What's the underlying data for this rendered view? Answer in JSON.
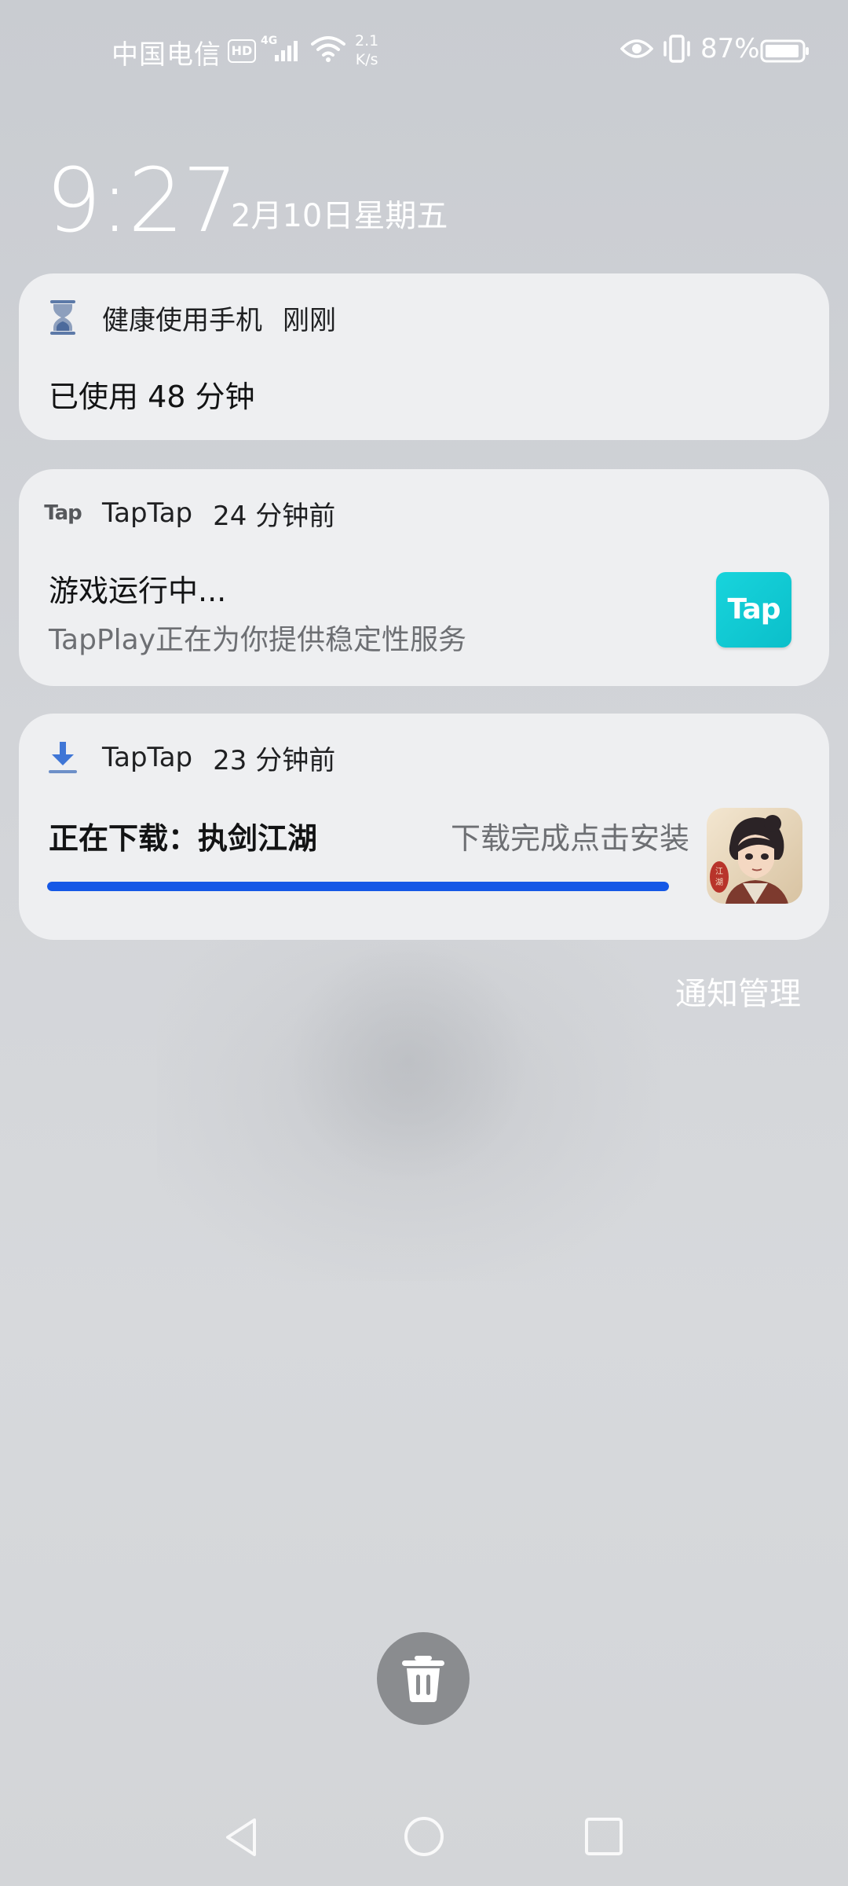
{
  "status_bar": {
    "carrier": "中国电信",
    "hd_badge": "HD",
    "network_type": "4G",
    "speed_value": "2.1",
    "speed_unit": "K/s",
    "battery": "87%",
    "icons": [
      "signal-icon",
      "wifi-icon",
      "eye-icon",
      "vibrate-icon",
      "battery-icon"
    ]
  },
  "lockscreen": {
    "time": "9:27",
    "date": "2月10日星期五"
  },
  "notifications": [
    {
      "app_name": "健康使用手机",
      "time": "刚刚",
      "title": "已使用 48 分钟",
      "icon": "hourglass-icon"
    },
    {
      "app_name": "TapTap",
      "app_icon_text": "Tap",
      "time": "24 分钟前",
      "title": "游戏运行中...",
      "text": "TapPlay正在为你提供稳定性服务",
      "large_icon_text": "Tap"
    },
    {
      "app_name": "TapTap",
      "time": "23 分钟前",
      "title": "正在下载：执剑江湖",
      "status": "下载完成点击安装",
      "progress": 1.0,
      "icon": "download-icon",
      "large_icon": "game-icon"
    }
  ],
  "notification_manage": "通知管理",
  "colors": {
    "accent": "#1558e6",
    "tap_brand": "#14c8d2",
    "card_bg": "#eeeff1"
  },
  "nav_bar": {
    "icons": [
      "back-icon",
      "home-icon",
      "recents-icon"
    ]
  }
}
